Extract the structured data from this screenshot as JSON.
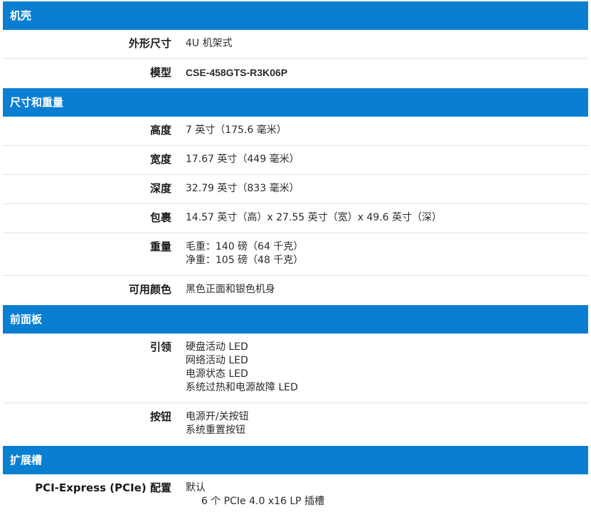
{
  "sections": [
    {
      "title": "机壳",
      "rows": [
        {
          "label": "外形尺寸",
          "lines": [
            "4U 机架式"
          ]
        },
        {
          "label": "模型",
          "lines": [
            "CSE-458GTS-R3K06P"
          ]
        }
      ]
    },
    {
      "title": "尺寸和重量",
      "rows": [
        {
          "label": "高度",
          "lines": [
            "7 英寸（175.6 毫米）"
          ]
        },
        {
          "label": "宽度",
          "lines": [
            "17.67 英寸（449 毫米）"
          ]
        },
        {
          "label": "深度",
          "lines": [
            "32.79 英寸（833 毫米）"
          ]
        },
        {
          "label": "包裹",
          "lines": [
            "14.57 英寸（高）x 27.55 英寸（宽）x 49.6 英寸（深）"
          ]
        },
        {
          "label": "重量",
          "lines": [
            "毛重：140 磅（64 千克）",
            "净重：105 磅（48 千克）"
          ]
        },
        {
          "label": "可用颜色",
          "lines": [
            "黑色正面和银色机身"
          ]
        }
      ]
    },
    {
      "title": "前面板",
      "rows": [
        {
          "label": "引领",
          "lines": [
            "硬盘活动 LED",
            "网络活动 LED",
            "电源状态 LED",
            "系统过热和电源故障 LED"
          ]
        },
        {
          "label": "按钮",
          "lines": [
            "电源开/关按钮",
            "系统重置按钮"
          ]
        }
      ]
    },
    {
      "title": "扩展槽",
      "rows": [
        {
          "label": "PCI-Express (PCIe) 配置",
          "lines": [
            "默认",
            "6 个 PCIe 4.0 x16 LP 插槽"
          ]
        }
      ]
    }
  ]
}
